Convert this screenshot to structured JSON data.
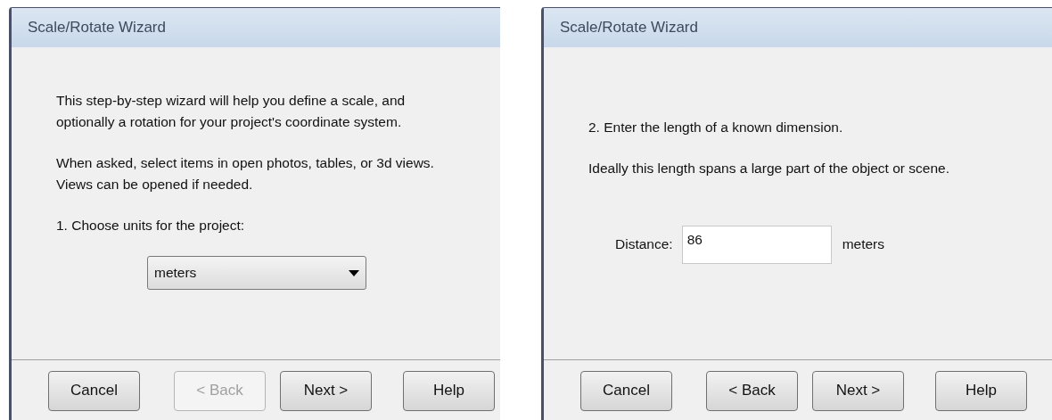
{
  "panels": [
    {
      "title": "Scale/Rotate Wizard",
      "blocks": [
        {
          "kind": "text",
          "text": "This step-by-step wizard will help you define a scale, and optionally a rotation for your project's coordinate system."
        },
        {
          "kind": "text",
          "text": "When asked, select items in open photos, tables, or 3d views. Views can be opened if needed."
        },
        {
          "kind": "text",
          "text": "1. Choose units for the project:"
        },
        {
          "kind": "dropdown",
          "value": "meters"
        }
      ],
      "buttons": [
        {
          "label": "Cancel",
          "disabled": false
        },
        {
          "label": "< Back",
          "disabled": true
        },
        {
          "label": "Next >",
          "disabled": false
        },
        {
          "label": "Help",
          "disabled": false
        }
      ]
    },
    {
      "title": "Scale/Rotate Wizard",
      "blocks": [
        {
          "kind": "text",
          "text": "2. Enter the length of a known dimension."
        },
        {
          "kind": "text",
          "text": "Ideally this length spans a large part of the object or scene."
        },
        {
          "kind": "field",
          "label": "Distance:",
          "value": "86",
          "unit": "meters"
        }
      ],
      "buttons": [
        {
          "label": "Cancel",
          "disabled": false
        },
        {
          "label": "< Back",
          "disabled": false
        },
        {
          "label": "Next >",
          "disabled": false
        },
        {
          "label": "Help",
          "disabled": false
        }
      ]
    }
  ]
}
